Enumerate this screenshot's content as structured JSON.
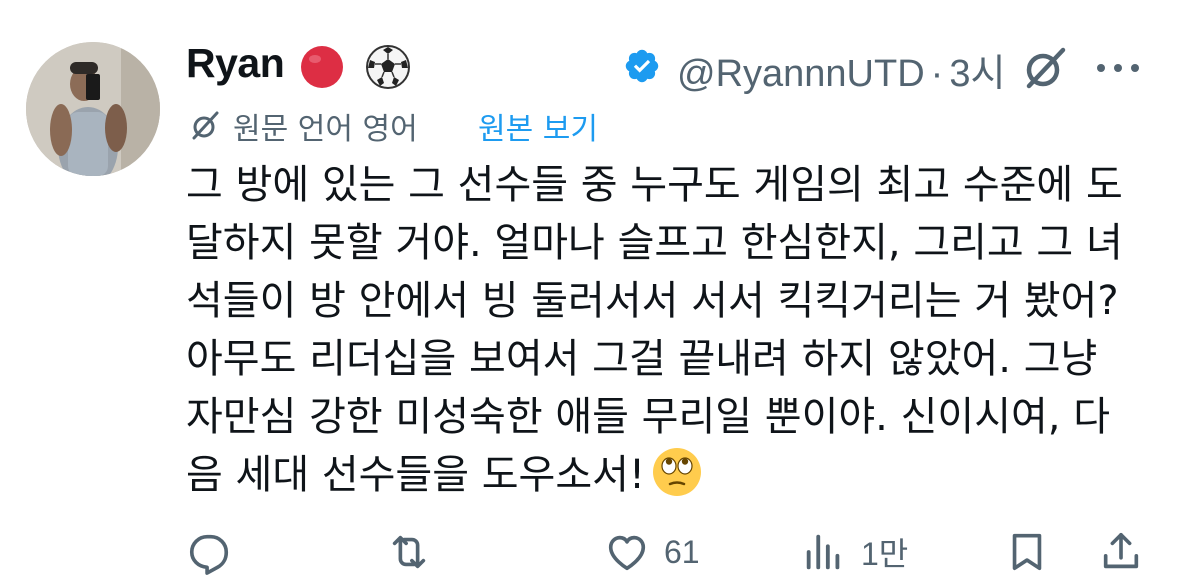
{
  "author": {
    "display_name": "Ryan",
    "handle": "@RyannnUTD",
    "separator": "·",
    "time": "3시",
    "badge_emojis": [
      "red-circle-icon",
      "soccer-ball-icon"
    ],
    "verified": true
  },
  "translation": {
    "info": "원문 언어 영어",
    "show_original": "원본 보기"
  },
  "tweet": {
    "lines": [
      "그 방에 있는 그 선수들 중 누구도 게임의 최고 수준에 도",
      "달하지 못할 거야. 얼마나 슬프고 한심한지, 그리고 그 녀",
      "석들이 방 안에서 빙 둘러서서 서서 킥킥거리는 거 봤어?",
      "아무도 리더십을 보여서 그걸 끝내려 하지 않았어. 그냥",
      "자만심 강한 미성숙한 애들 무리일 뿐이야. 신이시여, 다",
      "음 세대 선수들을 도우소서!"
    ],
    "trailing_emoji": "face-with-rolling-eyes-icon"
  },
  "actions": {
    "reply_count": "",
    "repost_count": "",
    "like_count": "61",
    "views_count": "1만"
  },
  "colors": {
    "text": "#0f1419",
    "secondary": "#536471",
    "link": "#1d9bf0",
    "verified": "#1d9bf0",
    "background": "#ffffff"
  }
}
